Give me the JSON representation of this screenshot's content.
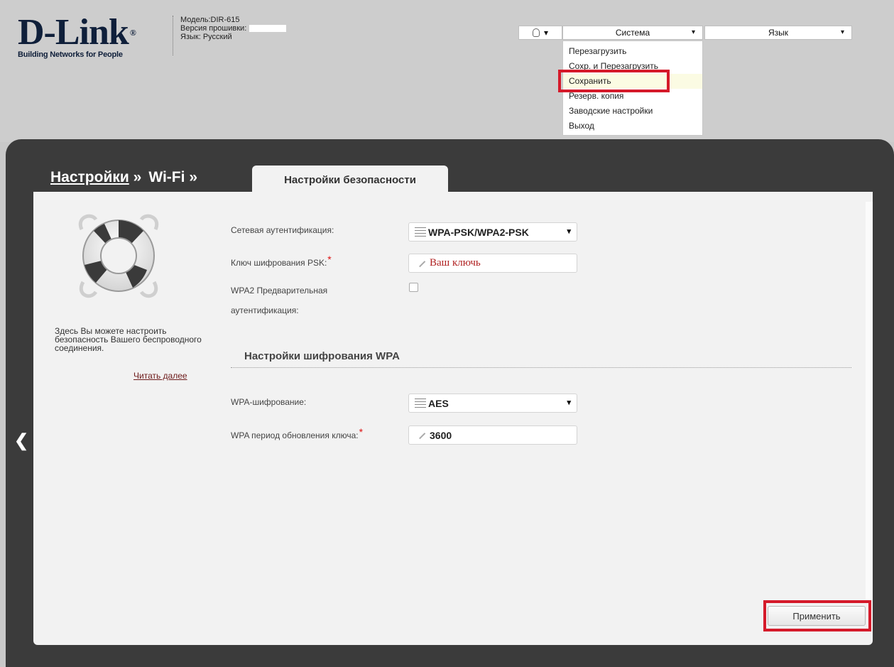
{
  "header": {
    "logo_text": "D-Link",
    "logo_reg": "®",
    "logo_tagline": "Building Networks for People",
    "model": "Модель:DIR-615",
    "firmware_label": "Версия прошивки:",
    "language_info": "Язык: Русский",
    "menu": {
      "system_label": "Система",
      "language_label": "Язык",
      "bulb_arrow": "▾",
      "system_arrow": "▾",
      "language_arrow": "▾"
    },
    "dropdown_items": [
      "Перезагрузить",
      "Сохр. и Перезагрузить",
      "Сохранить",
      "Резерв. копия",
      "Заводские настройки",
      "Выход"
    ]
  },
  "breadcrumb": {
    "settings": "Настройки",
    "sep1": "»",
    "wifi": "Wi-Fi",
    "sep2": "»"
  },
  "tab": {
    "label": "Настройки безопасности"
  },
  "sidebar": {
    "description": "Здесь Вы можете настроить безопасность Вашего беспроводного соединения.",
    "read_more": "Читать далее",
    "back_arrow": "❮"
  },
  "form": {
    "auth_label": "Сетевая аутентификация:",
    "auth_value": "WPA-PSK/WPA2-PSK",
    "psk_label": "Ключ шифрования PSK:",
    "psk_value": "Ваш ключь",
    "preauth_label_1": "WPA2 Предварительная",
    "preauth_label_2": "аутентификация:",
    "section_title": "Настройки шифрования WPA",
    "enc_label": "WPA-шифрование:",
    "enc_value": "AES",
    "rekey_label": "WPA период обновления ключа:",
    "rekey_value": "3600",
    "required_mark": "*",
    "select_arrow": "▾"
  },
  "actions": {
    "apply_label": "Применить"
  },
  "colors": {
    "highlight": "#d51a2a",
    "frame": "#3b3b3b",
    "panel": "#f2f2f2",
    "key_text": "#b02020"
  }
}
